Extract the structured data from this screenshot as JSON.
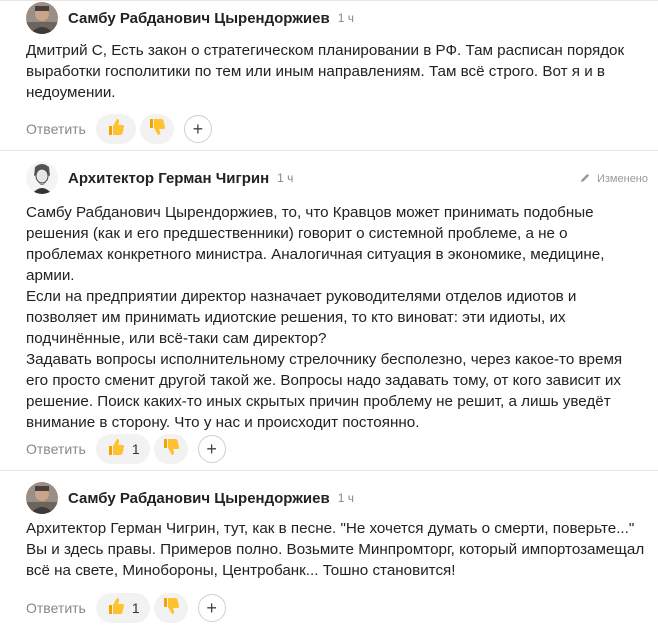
{
  "comments": [
    {
      "author": "Самбу Рабданович Цырендоржиев",
      "time": "1 ч",
      "text": "Дмитрий С, Есть закон о стратегическом планировании в РФ. Там расписан порядок выработки госполитики по тем или иным направлениям. Там всё строго. Вот я и в недоумении.",
      "reply_label": "Ответить",
      "like_count": ""
    },
    {
      "author": "Архитектор Герман Чигрин",
      "time": "1 ч",
      "edited_label": "Изменено",
      "text": "Самбу Рабданович Цырендоржиев, то, что Кравцов может принимать подобные решения (как и его предшественники) говорит о системной проблеме, а не о проблемах конкретного министра. Аналогичная ситуация в экономике, медицине, армии.\nЕсли на предприятии директор назначает руководителями отделов идиотов и позволяет им принимать идиотские решения, то кто виноват: эти идиоты, их подчинённые, или всё-таки сам директор?\nЗадавать вопросы исполнительному стрелочнику бесполезно, через какое-то время его просто сменит другой такой же. Вопросы надо задавать тому, от кого зависит их решение. Поиск каких-то иных скрытых причин проблему не решит, а лишь уведёт внимание в сторону. Что у нас и происходит постоянно.",
      "reply_label": "Ответить",
      "like_count": "1"
    },
    {
      "author": "Самбу Рабданович Цырендоржиев",
      "time": "1 ч",
      "text": "Архитектор Герман Чигрин, тут, как в песне. \"Не хочется думать о смерти, поверьте...\" Вы и здесь правы. Примеров полно. Возьмите Минпромторг, который импортозамещал всё на свете, Минобороны, Центробанк... Тошно становится!",
      "reply_label": "Ответить",
      "like_count": "1"
    }
  ]
}
